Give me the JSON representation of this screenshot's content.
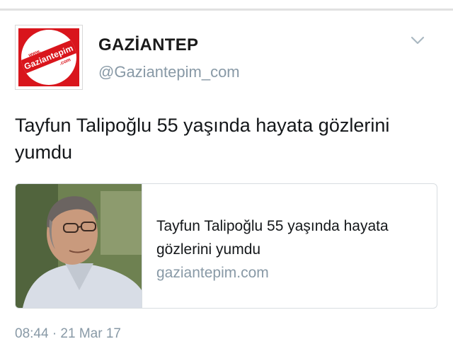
{
  "tweet": {
    "author": {
      "display_name": "GAZİANTEP",
      "handle": "@Gaziantepim_com",
      "avatar": {
        "logo_text": "Gaziantepim",
        "logo_prefix": "www.",
        "logo_suffix": ".com",
        "colors": {
          "primary": "#d9151c",
          "secondary": "#ffffff"
        }
      }
    },
    "text": "Tayfun Talipoğlu 55 yaşında hayata gözlerini yumdu",
    "card": {
      "image": "portrait-photo",
      "title": "Tayfun Talipoğlu 55 yaşında hayata gözlerini yumdu",
      "domain": "gaziantepim.com"
    },
    "timestamp": "08:44 · 21 Mar 17",
    "menu_icon": "chevron-down-icon"
  },
  "colors": {
    "text_primary": "#14171a",
    "text_secondary": "#8899a6",
    "border": "#d8dde1"
  }
}
